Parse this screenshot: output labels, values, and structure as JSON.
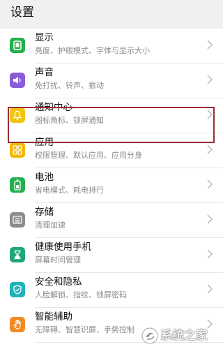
{
  "header": {
    "title": "设置"
  },
  "items": [
    {
      "label": "显示",
      "sub": "亮度、护眼模式、字体与显示大小",
      "icon": "display-icon",
      "color": "#22b14c"
    },
    {
      "label": "声音",
      "sub": "免打扰、铃声、振动",
      "icon": "sound-icon",
      "color": "#8a5cd6"
    },
    {
      "label": "通知中心",
      "sub": "图标角标、锁屏通知",
      "icon": "bell-icon",
      "color": "#f2c511"
    },
    {
      "label": "应用",
      "sub": "权限管理、默认应用、应用分身",
      "icon": "apps-grid-icon",
      "color": "#f2b705"
    },
    {
      "label": "电池",
      "sub": "省电模式、耗电排行",
      "icon": "battery-icon",
      "color": "#22b14c"
    },
    {
      "label": "存储",
      "sub": "清理加速",
      "icon": "storage-icon",
      "color": "#8c8c8c"
    },
    {
      "label": "健康使用手机",
      "sub": "屏幕时间管理",
      "icon": "hourglass-icon",
      "color": "#1fa67a"
    },
    {
      "label": "安全和隐私",
      "sub": "人脸解锁、指纹、锁屏密码",
      "icon": "shield-icon",
      "color": "#1eb2b9"
    },
    {
      "label": "智能辅助",
      "sub": "无障碍、智慧识屏、手势控制",
      "icon": "hand-icon",
      "color": "#f08a24"
    }
  ],
  "highlight": {
    "color": "#9b2a36"
  },
  "watermark": {
    "text": "系统之家",
    "icon": "logo-icon"
  }
}
